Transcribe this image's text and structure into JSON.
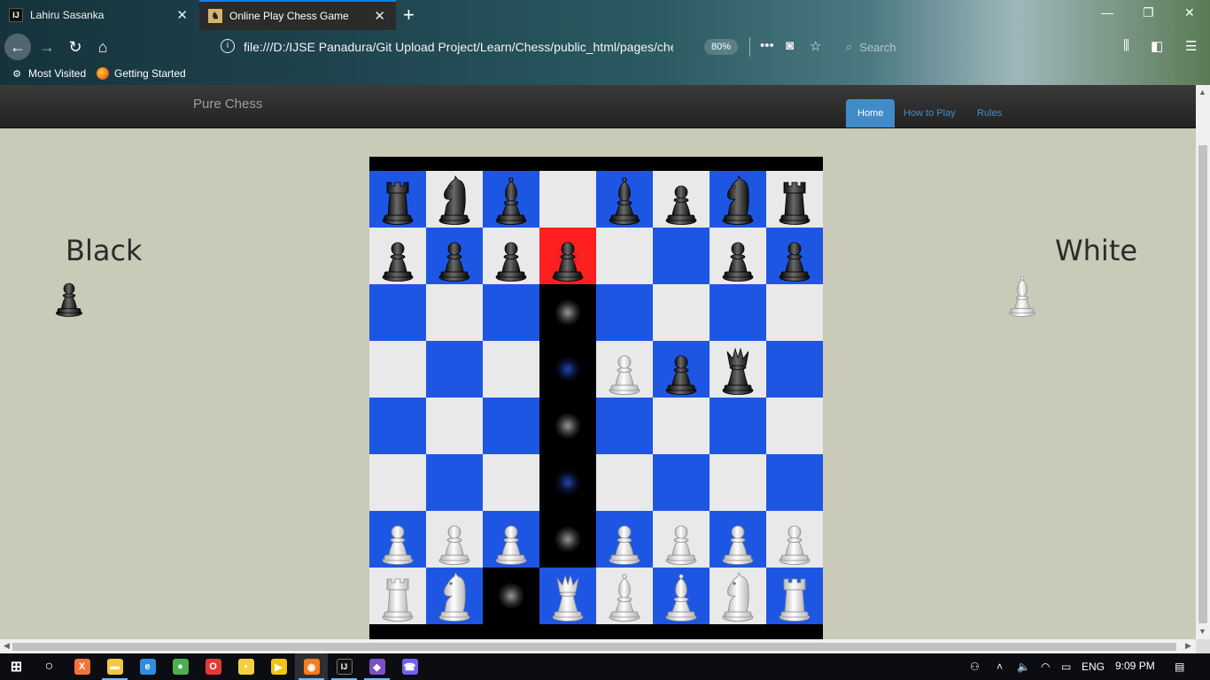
{
  "browser": {
    "tabs": [
      {
        "title": "Lahiru Sasanka",
        "favicon": "IJ",
        "active": false
      },
      {
        "title": "Online Play Chess Game",
        "favicon": "♞",
        "active": true
      }
    ],
    "url": "file:///D:/IJSE Panadura/Git Upload Project/Learn/Chess/public_html/pages/chess",
    "zoom": "80%",
    "search_placeholder": "Search",
    "bookmarks": [
      {
        "label": "Most Visited",
        "icon": "gear-icon"
      },
      {
        "label": "Getting Started",
        "icon": "firefox-icon"
      }
    ]
  },
  "site": {
    "brand": "Pure Chess",
    "nav": [
      {
        "label": "Home",
        "active": true
      },
      {
        "label": "How to Play",
        "active": false
      },
      {
        "label": "Rules",
        "active": false
      }
    ]
  },
  "players": {
    "black_label": "Black",
    "white_label": "White",
    "black_turn_piece": "bp",
    "white_turn_piece": "wb"
  },
  "board": {
    "light_color": "#e9e9e9",
    "dark_color": "#1e56e4",
    "selected_color": "#ff1f1f",
    "selected_square": [
      1,
      3
    ],
    "highlight_path": [
      [
        2,
        3
      ],
      [
        3,
        3
      ],
      [
        4,
        3
      ],
      [
        5,
        3
      ],
      [
        6,
        3
      ],
      [
        7,
        2
      ]
    ],
    "move_hints": [
      {
        "square": [
          2,
          3
        ],
        "tone": "g"
      },
      {
        "square": [
          3,
          3
        ],
        "tone": "b"
      },
      {
        "square": [
          4,
          3
        ],
        "tone": "g"
      },
      {
        "square": [
          5,
          3
        ],
        "tone": "b"
      },
      {
        "square": [
          6,
          3
        ],
        "tone": "g"
      },
      {
        "square": [
          7,
          2
        ],
        "tone": "g"
      }
    ],
    "rows": [
      [
        "br",
        "bn",
        "bb",
        "",
        "bb",
        "bp",
        "bn",
        "br"
      ],
      [
        "bp",
        "bp",
        "bp",
        "bp",
        "",
        "",
        "bp",
        "bp"
      ],
      [
        "",
        "",
        "",
        "",
        "",
        "",
        "",
        ""
      ],
      [
        "",
        "",
        "",
        "",
        "wp",
        "bp",
        "bq",
        ""
      ],
      [
        "",
        "",
        "",
        "",
        "",
        "",
        "",
        ""
      ],
      [
        "",
        "",
        "",
        "",
        "",
        "",
        "",
        ""
      ],
      [
        "wp",
        "wp",
        "wp",
        "",
        "wp",
        "wp",
        "wp",
        "wp"
      ],
      [
        "wr",
        "wn",
        "",
        "wq",
        "wb",
        "wb",
        "wn",
        "wr"
      ]
    ]
  },
  "taskbar": {
    "apps": [
      {
        "name": "start-button",
        "glyph": "⊞"
      },
      {
        "name": "cortana-icon",
        "glyph": "○"
      },
      {
        "name": "xampp-icon",
        "glyph": "X"
      },
      {
        "name": "file-explorer-icon",
        "glyph": "▬"
      },
      {
        "name": "edge-icon",
        "glyph": "e"
      },
      {
        "name": "chrome-icon",
        "glyph": "●"
      },
      {
        "name": "opera-icon",
        "glyph": "O"
      },
      {
        "name": "sticky-notes-icon",
        "glyph": "▪"
      },
      {
        "name": "media-player-icon",
        "glyph": "▶"
      },
      {
        "name": "firefox-icon",
        "glyph": "◉"
      },
      {
        "name": "intellij-icon",
        "glyph": "IJ"
      },
      {
        "name": "visual-studio-icon",
        "glyph": "◆"
      },
      {
        "name": "viber-icon",
        "glyph": "☎"
      }
    ],
    "language": "ENG",
    "time": "9:09 PM"
  }
}
